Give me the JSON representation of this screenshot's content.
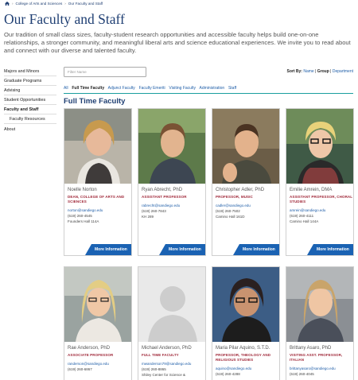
{
  "breadcrumb": {
    "items": [
      "College of Arts and Sciences",
      "Our Faculty and Staff"
    ]
  },
  "page_title": "Our Faculty and Staff",
  "intro": "Our tradition of small class sizes, faculty-student research opportunities and accessible faculty helps build one-on-one relationships, a stronger community, and meaningful liberal arts and science educational experiences. We invite you to read about and connect with our diverse and talented faculty.",
  "sidebar": {
    "items": [
      {
        "label": "Majors and Minors"
      },
      {
        "label": "Graduate Programs"
      },
      {
        "label": "Advising"
      },
      {
        "label": "Student Opportunities"
      },
      {
        "label": "Faculty and Staff"
      },
      {
        "label": "Faculty Resources"
      },
      {
        "label": "About"
      }
    ]
  },
  "filter": {
    "placeholder": "Filter Name"
  },
  "sort": {
    "label": "Sort By:",
    "name": "Name",
    "group": "Group",
    "department": "Department"
  },
  "tabs": [
    "All",
    "Full Time Faculty",
    "Adjunct Faculty",
    "Faculty Emeriti",
    "Visiting Faculty",
    "Administration",
    "Staff"
  ],
  "section_title": "Full Time Faculty",
  "more_label": "More Information",
  "colors": {
    "navy": "#1f3f73",
    "link": "#1f5ea8",
    "role_red": "#a0293a",
    "teal_rule": "#1a9e9e",
    "button_blue": "#1a62b3"
  },
  "cards": [
    {
      "name": "Noelle Norton",
      "role": "DEAN, COLLEGE OF ARTS AND SCIENCES",
      "email": "norton@sandiego.edu",
      "phone": "(619) 260-4545",
      "office": "Founders Hall 114A",
      "photo": "portrait-photo"
    },
    {
      "name": "Ryan Abrecht, PhD",
      "role": "ASSISTANT PROFESSOR",
      "email": "rabrecht@sandiego.edu",
      "phone": "(619) 260-7843",
      "office": "KH 289",
      "photo": "portrait-photo"
    },
    {
      "name": "Christopher Adler, PhD",
      "role": "PROFESSOR, MUSIC",
      "email": "cadler@sandiego.edu",
      "phone": "(619) 260-7502",
      "office": "Camino Hall 161D",
      "photo": "portrait-photo"
    },
    {
      "name": "Emilie Amrein, DMA",
      "role": "ASSISTANT PROFESSOR, CHORAL STUDIES",
      "email": "amrein@sandiego.edu",
      "phone": "(619) 260-4111",
      "office": "Camino Hall 144A",
      "photo": "portrait-photo"
    },
    {
      "name": "Rae Anderson, PhD",
      "role": "ASSOCIATE PROFESSOR",
      "email": "randerson@sandiego.edu",
      "phone": "(619) 260-6867",
      "office": "",
      "photo": "portrait-photo"
    },
    {
      "name": "Michael Anderson, PhD",
      "role": "FULL TIME FACULTY",
      "email": "mwanderson79@sandiego.edu",
      "phone": "(619) 260-8865",
      "office": "Shiley Center for Science &",
      "photo": "placeholder-avatar"
    },
    {
      "name": "Maria Pilar Aquino, S.T.D.",
      "role": "PROFESSOR, THEOLOGY AND RELIGIOUS STUDIES",
      "email": "aquino@sandiego.edu",
      "phone": "(619) 260-4288",
      "office": "",
      "photo": "portrait-photo"
    },
    {
      "name": "Brittany Asaro, PhD",
      "role": "VISITING ASST. PROFESSOR, ITALIAN",
      "email": "brittanyasaro@sandiego.edu",
      "phone": "(619) 260-4045",
      "office": "",
      "photo": "portrait-photo"
    }
  ]
}
